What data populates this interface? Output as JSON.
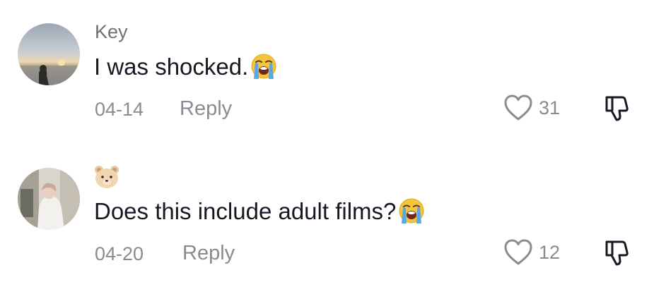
{
  "comments": [
    {
      "username": "Key",
      "avatar_icon": "sunset-beach-avatar",
      "text": "I was shocked.",
      "emoji": "loudly-crying-face-emoji",
      "date": "04-14",
      "reply_label": "Reply",
      "like_count": "31"
    },
    {
      "username_icon": "bear-face-emoji",
      "avatar_icon": "person-photo-avatar",
      "text": "Does this include adult films?",
      "emoji": "loudly-crying-face-emoji",
      "date": "04-20",
      "reply_label": "Reply",
      "like_count": "12"
    }
  ],
  "colors": {
    "text_primary": "#161823",
    "text_secondary": "#8a8b91",
    "username": "#6f7074"
  }
}
